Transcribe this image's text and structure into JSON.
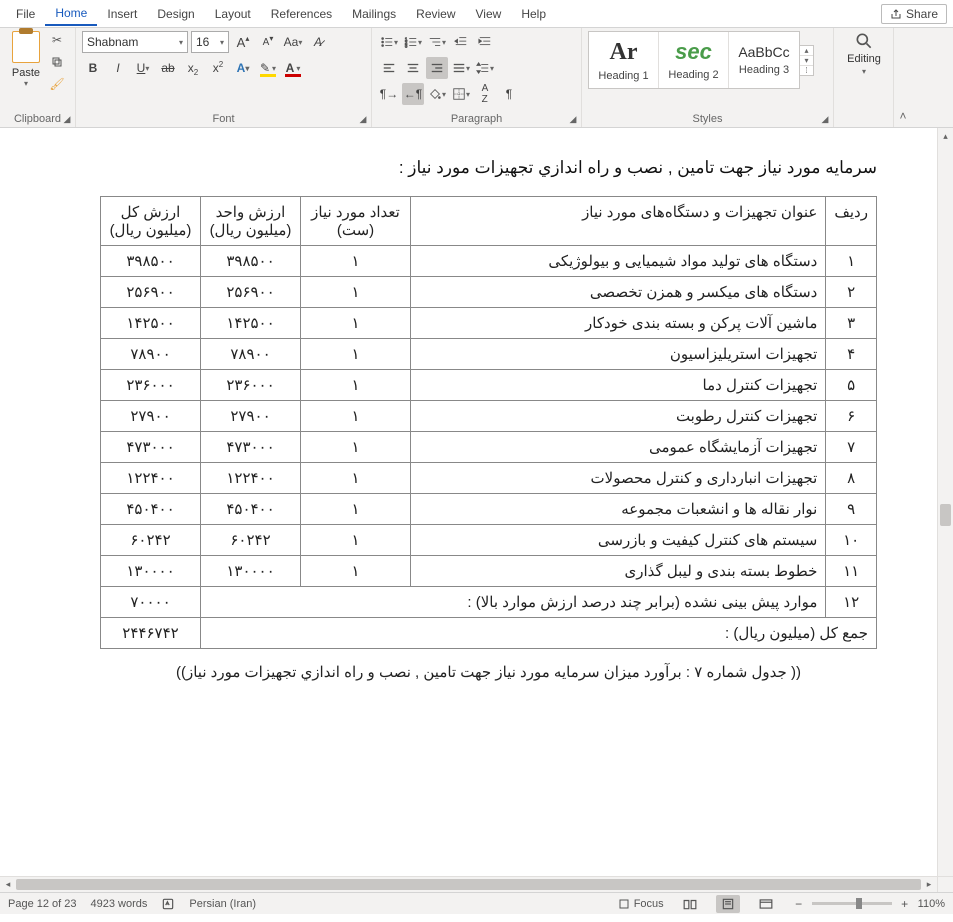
{
  "tabs": {
    "file": "File",
    "home": "Home",
    "insert": "Insert",
    "design": "Design",
    "layout": "Layout",
    "references": "References",
    "mailings": "Mailings",
    "review": "Review",
    "view": "View",
    "help": "Help"
  },
  "share": "Share",
  "groups": {
    "clipboard": "Clipboard",
    "font": "Font",
    "paragraph": "Paragraph",
    "styles": "Styles",
    "editing": "Editing"
  },
  "paste": "Paste",
  "font_name": "Shabnam",
  "font_size": "16",
  "style_previews": {
    "h1": "Ar",
    "h2": "sec",
    "h3": "AaBbCc"
  },
  "style_labels": {
    "h1": "Heading 1",
    "h2": "Heading 2",
    "h3": "Heading 3"
  },
  "doc": {
    "title": "سرمایه مورد نیاز جهت تامین , نصب و راه اندازي تجهیزات مورد نیاز :",
    "caption": "(( جدول شماره ۷ : برآورد میزان سرمایه مورد نیاز جهت تامین , نصب و راه اندازي تجهیزات مورد نیاز))",
    "headers": {
      "row": "ردیف",
      "name": "عنوان تجهیزات و دستگاه‌های مورد نیاز",
      "qty": "تعداد مورد نیاز (ست)",
      "unit": "ارزش واحد (میلیون ریال)",
      "total": "ارزش کل (میلیون ریال)"
    },
    "rows": [
      {
        "n": "۱",
        "name": "دستگاه های تولید مواد شیمیایی و بیولوژیکی",
        "qty": "۱",
        "unit": "۳۹۸۵۰۰",
        "total": "۳۹۸۵۰۰"
      },
      {
        "n": "۲",
        "name": "دستگاه های میکسر و همزن تخصصی",
        "qty": "۱",
        "unit": "۲۵۶۹۰۰",
        "total": "۲۵۶۹۰۰"
      },
      {
        "n": "۳",
        "name": "ماشین آلات پرکن و بسته بندی خودکار",
        "qty": "۱",
        "unit": "۱۴۲۵۰۰",
        "total": "۱۴۲۵۰۰"
      },
      {
        "n": "۴",
        "name": "تجهیزات استریلیزاسیون",
        "qty": "۱",
        "unit": "۷۸۹۰۰",
        "total": "۷۸۹۰۰"
      },
      {
        "n": "۵",
        "name": "تجهیزات کنترل دما",
        "qty": "۱",
        "unit": "۲۳۶۰۰۰",
        "total": "۲۳۶۰۰۰"
      },
      {
        "n": "۶",
        "name": "تجهیزات کنترل رطوبت",
        "qty": "۱",
        "unit": "۲۷۹۰۰",
        "total": "۲۷۹۰۰"
      },
      {
        "n": "۷",
        "name": "تجهیزات آزمایشگاه عمومی",
        "qty": "۱",
        "unit": "۴۷۳۰۰۰",
        "total": "۴۷۳۰۰۰"
      },
      {
        "n": "۸",
        "name": "تجهیزات انبارداری و کنترل محصولات",
        "qty": "۱",
        "unit": "۱۲۲۴۰۰",
        "total": "۱۲۲۴۰۰"
      },
      {
        "n": "۹",
        "name": "نوار نقاله ها و انشعبات مجموعه",
        "qty": "۱",
        "unit": "۴۵۰۴۰۰",
        "total": "۴۵۰۴۰۰"
      },
      {
        "n": "۱۰",
        "name": "سیستم های کنترل کیفیت و بازرسی",
        "qty": "۱",
        "unit": "۶۰۲۴۲",
        "total": "۶۰۲۴۲"
      },
      {
        "n": "۱۱",
        "name": "خطوط بسته بندی و لیبل گذاری",
        "qty": "۱",
        "unit": "۱۳۰۰۰۰",
        "total": "۱۳۰۰۰۰"
      }
    ],
    "misc_row": {
      "n": "۱۲",
      "name": "موارد پیش بینی نشده (برابر چند درصد ارزش موارد بالا) :",
      "total": "۷۰۰۰۰"
    },
    "sum_row": {
      "label": "جمع کل (میلیون ریال) :",
      "total": "۲۴۴۶۷۴۲"
    }
  },
  "status": {
    "page": "Page 12 of 23",
    "words": "4923 words",
    "lang": "Persian (Iran)",
    "focus": "Focus",
    "zoom": "110%"
  }
}
